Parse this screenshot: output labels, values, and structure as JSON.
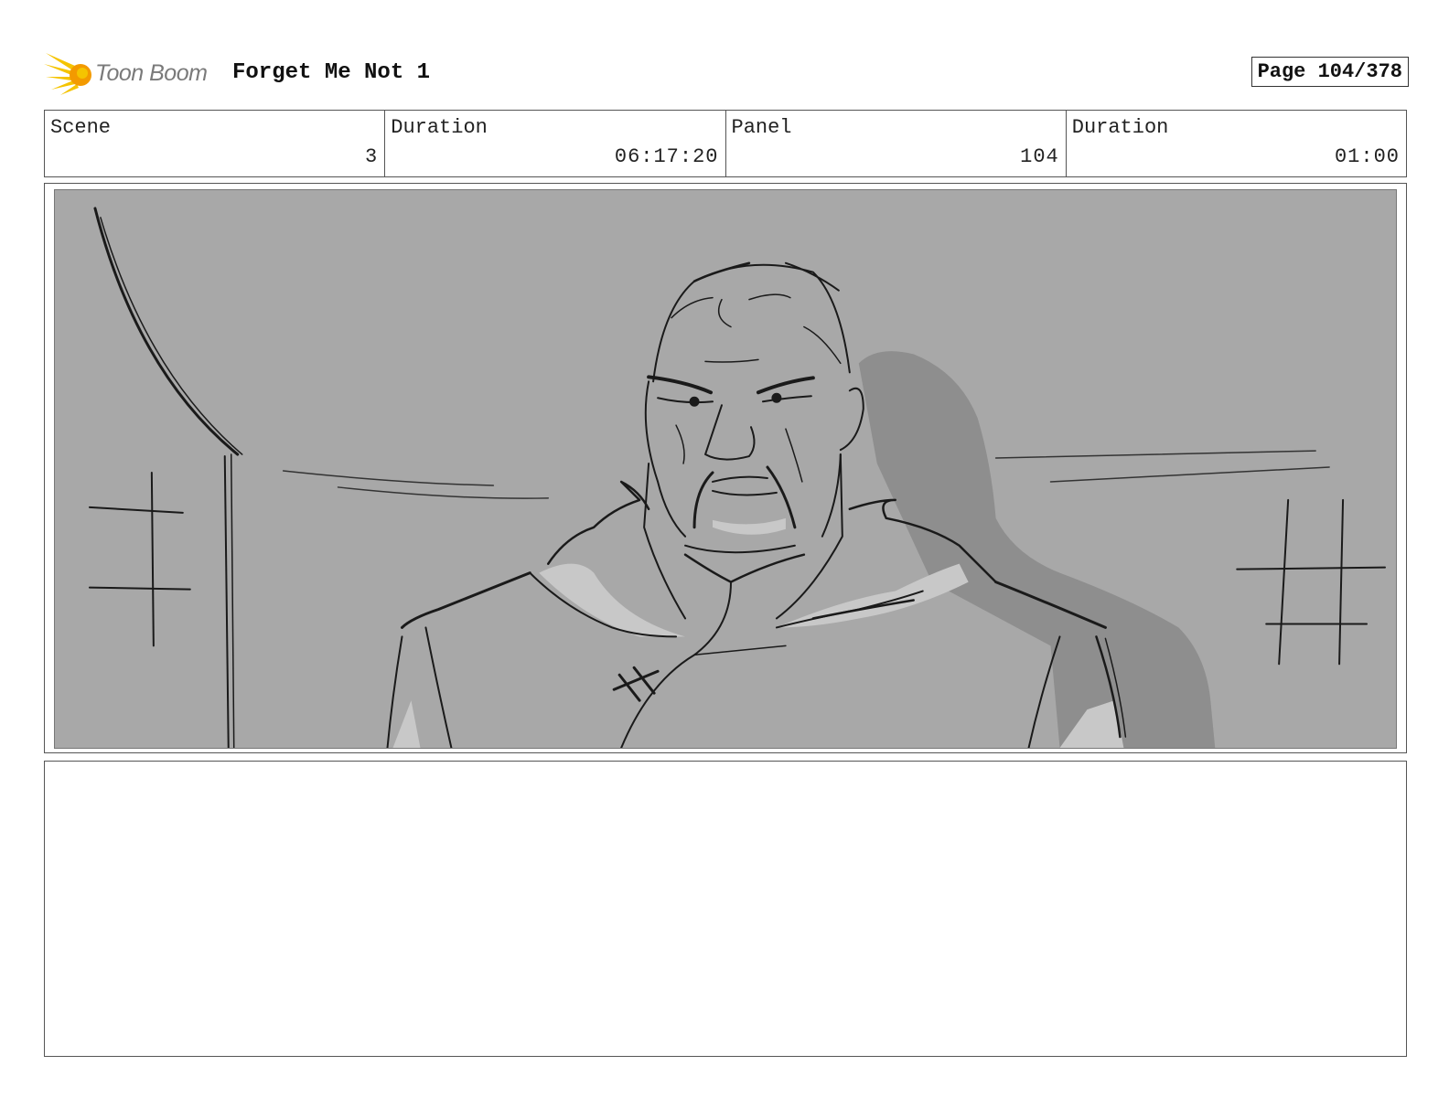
{
  "header": {
    "brand": "Toon Boom",
    "title": "Forget Me Not 1",
    "page_label": "Page 104/378"
  },
  "info": [
    {
      "label": "Scene",
      "value": "3"
    },
    {
      "label": "Duration",
      "value": "06:17:20"
    },
    {
      "label": "Panel",
      "value": "104"
    },
    {
      "label": "Duration",
      "value": "01:00"
    }
  ],
  "panel": {
    "background_color": "#a8a8a8",
    "shadow_color": "#8e8e8e",
    "highlight_color": "#c8c8c8",
    "line_color": "#1a1a1a"
  },
  "notes": {
    "text": ""
  },
  "icons": {
    "logo": "sunburst-logo-icon"
  },
  "colors": {
    "logo_yellow": "#f5c400",
    "logo_orange": "#f39a00"
  }
}
